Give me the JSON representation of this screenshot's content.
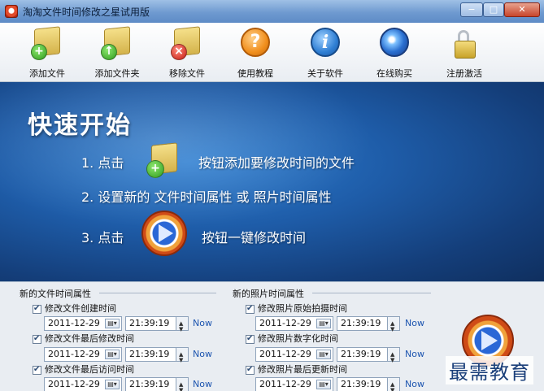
{
  "window": {
    "title": "淘淘文件时间修改之星试用版",
    "controls": {
      "minimize": "−",
      "maximize": "□",
      "close": "✕"
    }
  },
  "toolbar": {
    "add_file": "添加文件",
    "add_folder": "添加文件夹",
    "remove_file": "移除文件",
    "tutorial": "使用教程",
    "about": "关于软件",
    "buy_online": "在线购买",
    "register": "注册激活"
  },
  "banner": {
    "title": "快速开始",
    "step1_prefix": "1. 点击",
    "step1_suffix": "按钮添加要修改时间的文件",
    "step2": "2. 设置新的 文件时间属性 或 照片时间属性",
    "step3_prefix": "3. 点击",
    "step3_suffix": "按钮一键修改时间"
  },
  "file_time": {
    "group_title": "新的文件时间属性",
    "rows": [
      {
        "label": "修改文件创建时间",
        "date": "2011-12-29",
        "time": "21:39:19",
        "now": "Now"
      },
      {
        "label": "修改文件最后修改时间",
        "date": "2011-12-29",
        "time": "21:39:19",
        "now": "Now"
      },
      {
        "label": "修改文件最后访问时间",
        "date": "2011-12-29",
        "time": "21:39:19",
        "now": "Now"
      }
    ]
  },
  "photo_time": {
    "group_title": "新的照片时间属性",
    "rows": [
      {
        "label": "修改照片原始拍摄时间",
        "date": "2011-12-29",
        "time": "21:39:19",
        "now": "Now"
      },
      {
        "label": "修改照片数字化时间",
        "date": "2011-12-29",
        "time": "21:39:19",
        "now": "Now"
      },
      {
        "label": "修改照片最后更新时间",
        "date": "2011-12-29",
        "time": "21:39:19",
        "now": "Now"
      }
    ]
  },
  "watermark": "最需教育"
}
